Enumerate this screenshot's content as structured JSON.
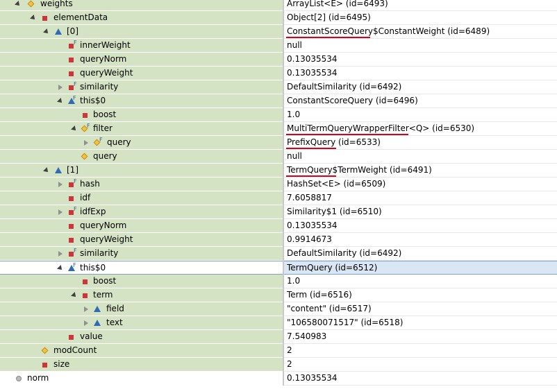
{
  "rows": [
    {
      "name": "weights",
      "value": "ArrayList<E>  (id=6493)"
    },
    {
      "name": "elementData",
      "value": "Object[2]  (id=6495)"
    },
    {
      "name": "[0]",
      "value": "ConstantScoreQuery$ConstantWeight  (id=6489)"
    },
    {
      "name": "innerWeight",
      "value": "null"
    },
    {
      "name": "queryNorm",
      "value": "0.13035534"
    },
    {
      "name": "queryWeight",
      "value": "0.13035534"
    },
    {
      "name": "similarity",
      "value": "DefaultSimilarity  (id=6492)"
    },
    {
      "name": "this$0",
      "value": "ConstantScoreQuery  (id=6496)"
    },
    {
      "name": "boost",
      "value": "1.0"
    },
    {
      "name": "filter",
      "value": "MultiTermQueryWrapperFilter<Q>  (id=6530)"
    },
    {
      "name": "query",
      "value": "PrefixQuery  (id=6533)"
    },
    {
      "name": "query",
      "value": "null"
    },
    {
      "name": "[1]",
      "value": "TermQuery$TermWeight  (id=6491)"
    },
    {
      "name": "hash",
      "value": "HashSet<E>  (id=6509)"
    },
    {
      "name": "idf",
      "value": "7.6058817"
    },
    {
      "name": "idfExp",
      "value": "Similarity$1  (id=6510)"
    },
    {
      "name": "queryNorm",
      "value": "0.13035534"
    },
    {
      "name": "queryWeight",
      "value": "0.9914673"
    },
    {
      "name": "similarity",
      "value": "DefaultSimilarity  (id=6492)"
    },
    {
      "name": "this$0",
      "value": "TermQuery  (id=6512)"
    },
    {
      "name": "boost",
      "value": "1.0"
    },
    {
      "name": "term",
      "value": "Term  (id=6516)"
    },
    {
      "name": "field",
      "value": "\"content\" (id=6517)"
    },
    {
      "name": "text",
      "value": "\"106580071517\" (id=6518)"
    },
    {
      "name": "value",
      "value": "7.540983"
    },
    {
      "name": "modCount",
      "value": "2"
    },
    {
      "name": "size",
      "value": "2"
    },
    {
      "name": "norm",
      "value": "0.13035534"
    }
  ],
  "colors": {
    "annotation_underline": "#d6001c",
    "selected_row": "#dbe6f4"
  }
}
